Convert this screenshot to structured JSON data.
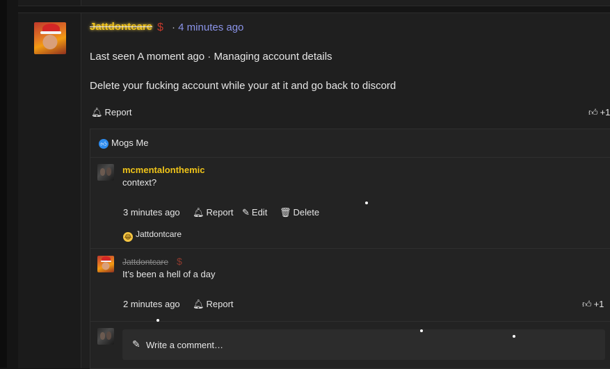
{
  "post": {
    "author": "Jattdontcare",
    "author_badge": "$",
    "time": "4 minutes ago",
    "separator": "·",
    "status": "Last seen A moment ago · Managing account details",
    "body": "Delete your fucking account while your at it and go back to discord",
    "report_label": "Report",
    "like_label": "+1"
  },
  "reactions_bar": {
    "label": "Mogs Me",
    "icon": "thumbs-up-icon",
    "color": "#2d8cf0"
  },
  "comments": [
    {
      "author": "mcmentalonthemic",
      "text": "context?",
      "time": "3 minutes ago",
      "report_label": "Report",
      "edit_label": "Edit",
      "delete_label": "Delete",
      "reactor": "Jattdontcare"
    },
    {
      "author": "Jattdontcare",
      "author_badge": "$",
      "text": "It’s been a hell of a day",
      "time": "2 minutes ago",
      "report_label": "Report",
      "like_label": "+1"
    }
  ],
  "composer": {
    "placeholder": "Write a comment…"
  },
  "colors": {
    "accent_name": "#f0c419",
    "link_time": "#8a93e8",
    "background": "#1f1f1f"
  }
}
